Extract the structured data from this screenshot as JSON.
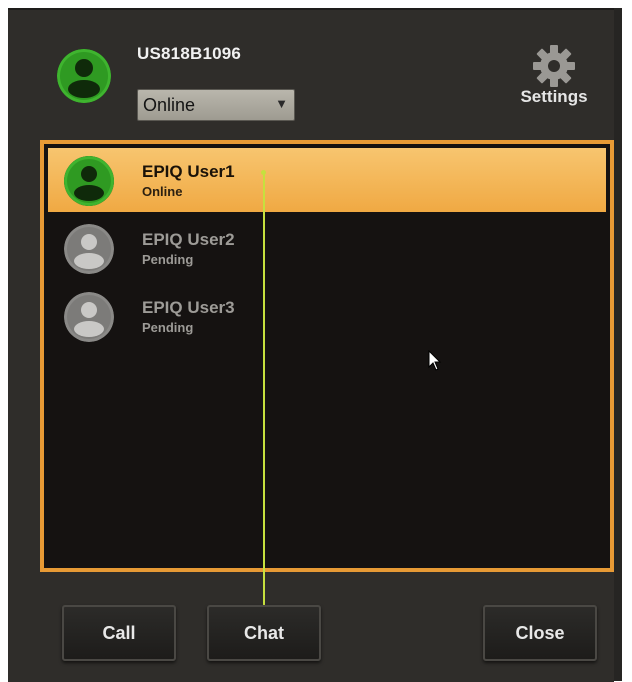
{
  "header": {
    "username": "US818B1096",
    "status_value": "Online",
    "settings_label": "Settings"
  },
  "contacts": [
    {
      "name": "EPIQ User1",
      "status": "Online",
      "avatar": "user-online-icon"
    },
    {
      "name": "EPIQ User2",
      "status": "Pending",
      "avatar": "user-pending-icon"
    },
    {
      "name": "EPIQ User3",
      "status": "Pending",
      "avatar": "user-pending-icon"
    }
  ],
  "buttons": {
    "call": "Call",
    "chat": "Chat",
    "close": "Close"
  },
  "colors": {
    "accent": "#e79a35",
    "selected_row": "#f3b559",
    "online_green": "#36b02a",
    "panel_bg": "#151211",
    "window_bg": "#2f2d2a",
    "guide_line": "#c6e03e"
  }
}
